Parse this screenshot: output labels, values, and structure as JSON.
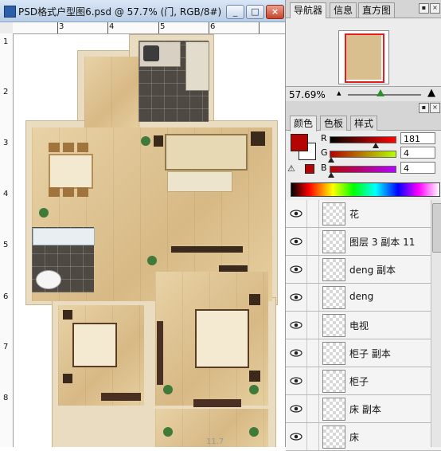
{
  "document": {
    "title": "PSD格式户型图6.psd @ 57.7% (门, RGB/8#)",
    "minimize_glyph": "_",
    "restore_glyph": "□",
    "close_glyph": "×",
    "ruler_top_labels": [
      "3",
      "4",
      "5",
      "6"
    ],
    "ruler_left_labels": [
      "1",
      "2",
      "3",
      "4",
      "5",
      "6",
      "7",
      "8"
    ],
    "bottom_partial_label": "11.7"
  },
  "navigator": {
    "tabs": [
      "导航器",
      "信息",
      "直方图"
    ],
    "active_tab": 0,
    "zoom": "57.69%",
    "zoom_slider_fraction": 0.45,
    "collapse_glyph": "▪",
    "close_glyph": "×"
  },
  "color": {
    "tabs": [
      "颜色",
      "色板",
      "样式"
    ],
    "active_tab": 0,
    "channels": [
      {
        "letter": "R",
        "value": "181",
        "fraction": 0.71
      },
      {
        "letter": "G",
        "value": "4",
        "fraction": 0.02
      },
      {
        "letter": "B",
        "value": "4",
        "fraction": 0.02
      }
    ],
    "foreground": "#b50404",
    "background": "#ffffff"
  },
  "layers": {
    "items": [
      {
        "name": "花"
      },
      {
        "name": "图层 3 副本 11"
      },
      {
        "name": "deng 副本"
      },
      {
        "name": "deng"
      },
      {
        "name": "电视"
      },
      {
        "name": "柜子 副本"
      },
      {
        "name": "柜子"
      },
      {
        "name": "床 副本"
      },
      {
        "name": "床"
      }
    ]
  }
}
